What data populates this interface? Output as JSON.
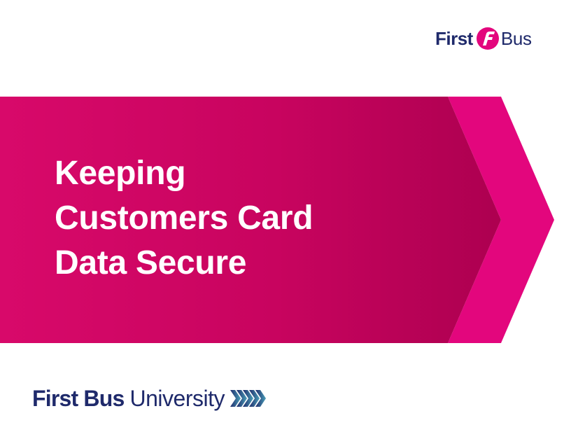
{
  "brand": {
    "top_logo_first": "First",
    "top_logo_bus": "Bus",
    "logo_mark_icon": "first-f-logo-icon",
    "university_bold": "First Bus",
    "university_light": "University",
    "university_icon": "chevrons-right-icon"
  },
  "headline": {
    "lines": [
      "Keeping",
      "Customers Card",
      "Data Secure"
    ]
  },
  "colors": {
    "navy": "#1f2a6b",
    "magenta": "#d4085f",
    "magenta_dark": "#b80055",
    "magenta_bright": "#e3067d",
    "teal": "#3f8ca6"
  }
}
